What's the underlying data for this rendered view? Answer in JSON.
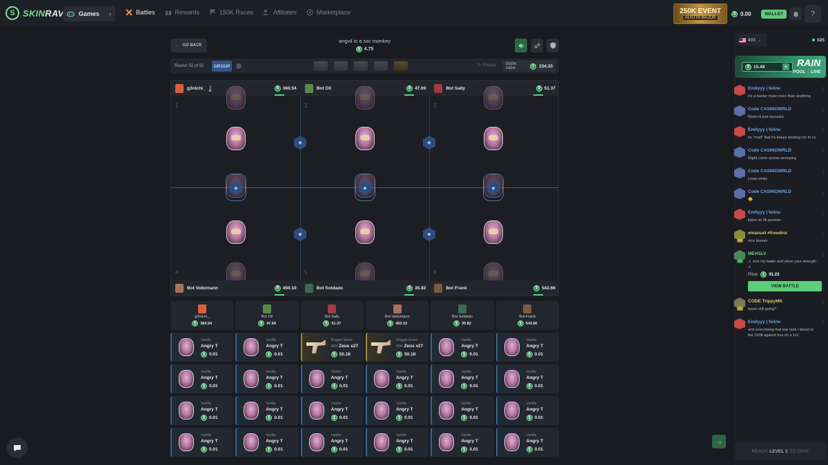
{
  "brand": {
    "name_a": "SKIN",
    "name_b": "RAVE"
  },
  "topnav": {
    "games": "Games",
    "items": [
      "Battles",
      "Rewards",
      "150K Races",
      "Affiliates",
      "Marketplace"
    ]
  },
  "event": {
    "line1": "250K EVENT",
    "line2": "AUSTIN MAJOR"
  },
  "wallet": {
    "balance": "0.00",
    "button": "WALLET"
  },
  "battle": {
    "go_back": "GO BACK",
    "title": "angvil is a sxc monkey",
    "cost": "4.75",
    "round_label": "Round",
    "round_value": "52 of 52",
    "mode": "GROUP",
    "replay": "Replay",
    "value_label": "Battle value",
    "value": "234.33"
  },
  "players_top": [
    {
      "name": "g3ntchi_",
      "value": "360.54",
      "color": "#d9603a"
    },
    {
      "name": "Bot Oil",
      "value": "47.69",
      "color": "#5a8a4a"
    },
    {
      "name": "Bot Sally",
      "value": "51.37",
      "color": "#a33a44"
    }
  ],
  "players_bottom": [
    {
      "name": "Bot Voltzmann",
      "value": "450.10",
      "color": "#a8735a"
    },
    {
      "name": "Bot Soldado",
      "value": "35.82",
      "color": "#3f6a4f"
    },
    {
      "name": "Bot Frank",
      "value": "543.66",
      "color": "#7a5a3f"
    }
  ],
  "slot_numbers": [
    "1",
    "2",
    "3",
    "4",
    "5",
    "6"
  ],
  "summary": [
    {
      "name": "g3ntchi_",
      "value": "360.54",
      "color": "#d9603a"
    },
    {
      "name": "Bot Oil",
      "value": "47.69",
      "color": "#5a8a4a"
    },
    {
      "name": "Bot Sally",
      "value": "51.37",
      "color": "#a33a44"
    },
    {
      "name": "Bot Voltzmann",
      "value": "450.10",
      "color": "#a8735a"
    },
    {
      "name": "Bot Soldado",
      "value": "35.82",
      "color": "#3f6a4f"
    },
    {
      "name": "Bot Frank",
      "value": "543.66",
      "color": "#7a5a3f"
    }
  ],
  "drops": [
    [
      {
        "rarity": "Vanilla",
        "name": "Angry T",
        "prefix": "",
        "price": "0.01",
        "kind": "sticker"
      },
      {
        "rarity": "Vanilla",
        "name": "Angry T",
        "prefix": "",
        "price": "0.01",
        "kind": "sticker"
      },
      {
        "rarity": "Dragon Snore",
        "name": "Zeus x27",
        "prefix": "WW",
        "price": "50.18",
        "kind": "gun"
      },
      {
        "rarity": "Dragon Snore",
        "name": "Zeus x27",
        "prefix": "WW",
        "price": "50.18",
        "kind": "gun"
      },
      {
        "rarity": "Vanilla",
        "name": "Angry T",
        "prefix": "",
        "price": "0.01",
        "kind": "sticker"
      },
      {
        "rarity": "Vanilla",
        "name": "Angry T",
        "prefix": "",
        "price": "0.01",
        "kind": "sticker"
      }
    ],
    [
      {
        "rarity": "Vanilla",
        "name": "Angry T",
        "prefix": "",
        "price": "0.01",
        "kind": "sticker"
      },
      {
        "rarity": "Vanilla",
        "name": "Angry T",
        "prefix": "",
        "price": "0.01",
        "kind": "sticker"
      },
      {
        "rarity": "Vanilla",
        "name": "Angry T",
        "prefix": "",
        "price": "0.01",
        "kind": "sticker"
      },
      {
        "rarity": "Vanilla",
        "name": "Angry T",
        "prefix": "",
        "price": "0.01",
        "kind": "sticker"
      },
      {
        "rarity": "Vanilla",
        "name": "Angry T",
        "prefix": "",
        "price": "0.01",
        "kind": "sticker"
      },
      {
        "rarity": "Vanilla",
        "name": "Angry T",
        "prefix": "",
        "price": "0.01",
        "kind": "sticker"
      }
    ],
    [
      {
        "rarity": "Vanilla",
        "name": "Angry T",
        "prefix": "",
        "price": "0.01",
        "kind": "sticker"
      },
      {
        "rarity": "Vanilla",
        "name": "Angry T",
        "prefix": "",
        "price": "0.01",
        "kind": "sticker"
      },
      {
        "rarity": "Vanilla",
        "name": "Angry T",
        "prefix": "",
        "price": "0.01",
        "kind": "sticker"
      },
      {
        "rarity": "Vanilla",
        "name": "Angry T",
        "prefix": "",
        "price": "0.01",
        "kind": "sticker"
      },
      {
        "rarity": "Vanilla",
        "name": "Angry T",
        "prefix": "",
        "price": "0.01",
        "kind": "sticker"
      },
      {
        "rarity": "Vanilla",
        "name": "Angry T",
        "prefix": "",
        "price": "0.01",
        "kind": "sticker"
      }
    ],
    [
      {
        "rarity": "Vanilla",
        "name": "Angry T",
        "prefix": "",
        "price": "0.01",
        "kind": "sticker"
      },
      {
        "rarity": "Vanilla",
        "name": "Angry T",
        "prefix": "",
        "price": "0.01",
        "kind": "sticker"
      },
      {
        "rarity": "Vanilla",
        "name": "Angry T",
        "prefix": "",
        "price": "0.01",
        "kind": "sticker"
      },
      {
        "rarity": "Vanilla",
        "name": "Angry T",
        "prefix": "",
        "price": "0.01",
        "kind": "sticker"
      },
      {
        "rarity": "Vanilla",
        "name": "Angry T",
        "prefix": "",
        "price": "0.01",
        "kind": "sticker"
      },
      {
        "rarity": "Vanilla",
        "name": "Angry T",
        "prefix": "",
        "price": "0.01",
        "kind": "sticker"
      }
    ]
  ],
  "chat": {
    "language_count": "403",
    "online": "525",
    "rain_amount": "15.49",
    "rain_title": "RAIN",
    "rain_pool": "POOL",
    "rain_live": "LIVE",
    "messages": [
      {
        "user": "Emilyyy | feline",
        "text": "it's a banter mute more than anything",
        "level": "",
        "tone": "blue",
        "avatar": "#c84a4a"
      },
      {
        "user": "Code CASINOWRLD",
        "text": "Riske is just sarcastic",
        "level": "",
        "tone": "blue",
        "avatar": "#5b6fa8"
      },
      {
        "user": "Emilyyy | feline",
        "text": "im \"mad\" that he keeps beating me in cs",
        "level": "",
        "tone": "blue",
        "avatar": "#c84a4a"
      },
      {
        "user": "Code CASINOWRLD",
        "text": "Might come across annoying",
        "level": "",
        "tone": "blue",
        "avatar": "#5b6fa8"
      },
      {
        "user": "Code CASINOWRLD",
        "text": "Lmao emily",
        "level": "",
        "tone": "blue",
        "avatar": "#5b6fa8"
      },
      {
        "user": "Code CASINOWRLD",
        "text": "😂",
        "level": "",
        "tone": "blue",
        "avatar": "#5b6fa8"
      },
      {
        "user": "Emilyyy | feline",
        "text": "listen im 2k premier",
        "level": "",
        "tone": "blue",
        "avatar": "#c84a4a"
      },
      {
        "user": "emanuel #freedinx",
        "text": "nice booom",
        "level": "44",
        "tone": "yellow",
        "avatar": "#8a8a3a"
      },
      {
        "user": "MEHSLV",
        "text": "⚔ Join my battle and show your strength ⚔",
        "level": "37",
        "tone": "green",
        "avatar": "#4a8a5a",
        "price_label": "Price:",
        "price": "91.23",
        "button": "VIEW BATTLE"
      },
      {
        "user": "CODE TrippyMK",
        "text": "boom still going?",
        "level": "43",
        "tone": "yellow",
        "avatar": "#7a7a5a"
      },
      {
        "user": "Emilyyy | feline",
        "text": "and even being that low rank i dared to bet 100$ against bus on a 1v1",
        "level": "",
        "tone": "blue",
        "avatar": "#c84a4a"
      }
    ],
    "reach_a": "REACH",
    "reach_level": "LEVEL 3",
    "reach_b": "TO CHAT"
  }
}
